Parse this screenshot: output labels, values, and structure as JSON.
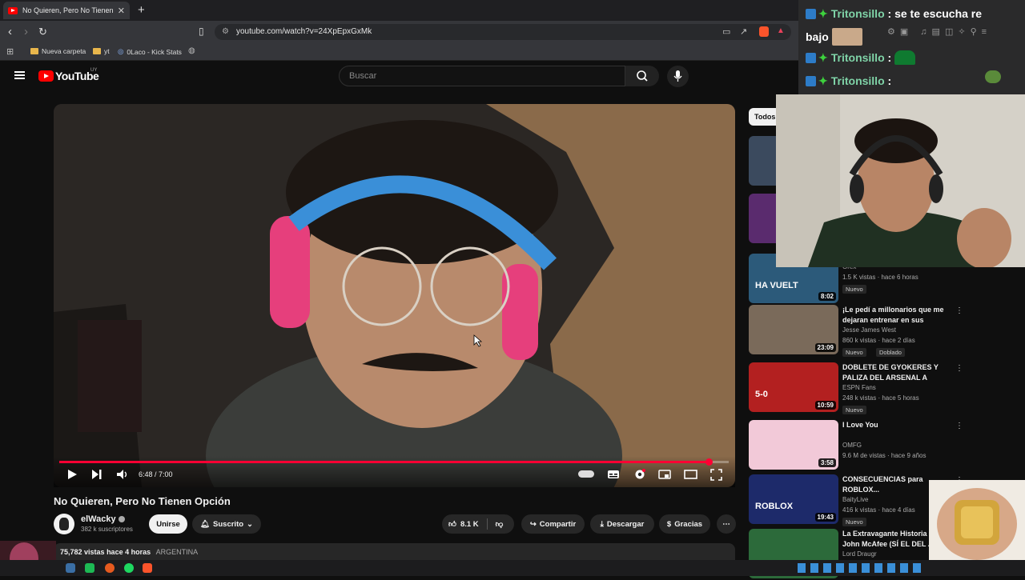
{
  "browser": {
    "tab_title": "No Quieren, Pero No Tienen Opción",
    "tab_close": "✕",
    "new_tab": "+",
    "url": "youtube.com/watch?v=24XpEpxGxMk",
    "bookmarks": [
      "Nueva carpeta",
      "yt",
      "0Laco - Kick Stats"
    ]
  },
  "youtube": {
    "logo_text": "YouTube",
    "country_code": "UY",
    "search_placeholder": "Buscar"
  },
  "video": {
    "current_time": "6:48 / 7:00",
    "progress": 0.971,
    "title": "No Quieren, Pero No Tienen Opción",
    "channel": "elWacky",
    "subscribers": "382 k suscriptores",
    "join_label": "Unirse",
    "subscribed_label": "Suscrito",
    "likes": "8.1 K",
    "share_label": "Compartir",
    "download_label": "Descargar",
    "thanks_label": "Gracias",
    "views": "75,782 vistas",
    "uploaded": "hace 4 horas",
    "country": "ARGENTINA"
  },
  "sidebar": {
    "chip_all": "Todos",
    "recs": [
      {
        "title": "",
        "channel": "Orex",
        "meta": "1.5 K vistas · hace 6 horas",
        "duration": "8:02",
        "badge": "Nuevo",
        "thumb_text": "HA VUELT"
      },
      {
        "title": "¡Le pedí a millonarios que me dejaran entrenar en sus casas!...",
        "channel": "Jesse James West",
        "meta": "860 k vistas · hace 2 días",
        "duration": "23:09",
        "badge": "Nuevo",
        "badge2": "Doblado"
      },
      {
        "title": "DOBLETE DE GYOKERES Y PALIZA DEL ARSENAL A LEED...",
        "channel": "ESPN Fans",
        "meta": "248 k vistas · hace 5 horas",
        "duration": "10:59",
        "badge": "Nuevo",
        "thumb_text": "5-0"
      },
      {
        "title": "I Love You",
        "channel": "OMFG",
        "meta": "9.6 M de vistas · hace 9 años",
        "duration": "3:58"
      },
      {
        "title": "CONSECUENCIAS para ROBLOX...",
        "channel": "BaityLive",
        "meta": "416 k vistas · hace 4 días",
        "duration": "19:43",
        "badge": "Nuevo",
        "thumb_text": "ROBLOX"
      },
      {
        "title": "La Extravagante Historia de John McAfee (SÍ EL DEL ...",
        "channel": "Lord Draugr",
        "meta": "",
        "duration": ""
      }
    ]
  },
  "chat": {
    "lines": [
      {
        "user": "Tritonsillo",
        "text": ": se te escucha re"
      },
      {
        "user": "",
        "text": "bajo"
      },
      {
        "user": "Tritonsillo",
        "text": ":"
      },
      {
        "user": "Tritonsillo",
        "text": ":"
      }
    ]
  },
  "colors": {
    "accent": "#ff0033",
    "background": "#0f0f0f",
    "chat_user": "#7fd3a7"
  }
}
